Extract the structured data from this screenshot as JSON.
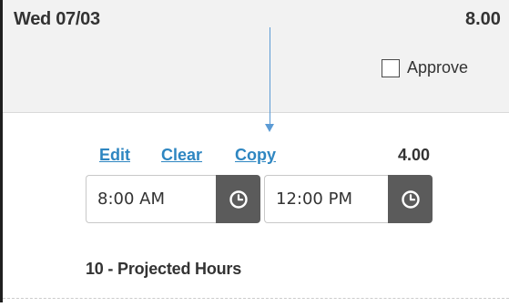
{
  "day": {
    "label": "Wed 07/03",
    "total_hours": "8.00"
  },
  "approve": {
    "label": "Approve",
    "checked": false
  },
  "entry": {
    "actions": {
      "edit": "Edit",
      "clear": "Clear",
      "copy": "Copy"
    },
    "hours": "4.00",
    "start_time": "8:00 AM",
    "end_time": "12:00 PM",
    "pay_code": "10 - Projected Hours"
  },
  "icons": {
    "clock": "clock-icon",
    "checkbox": "checkbox-icon"
  },
  "colors": {
    "link": "#2e86c1",
    "clock_button": "#5b5b5b",
    "annotation_arrow": "#5b9bd5",
    "header_bg": "#f2f2f2"
  }
}
